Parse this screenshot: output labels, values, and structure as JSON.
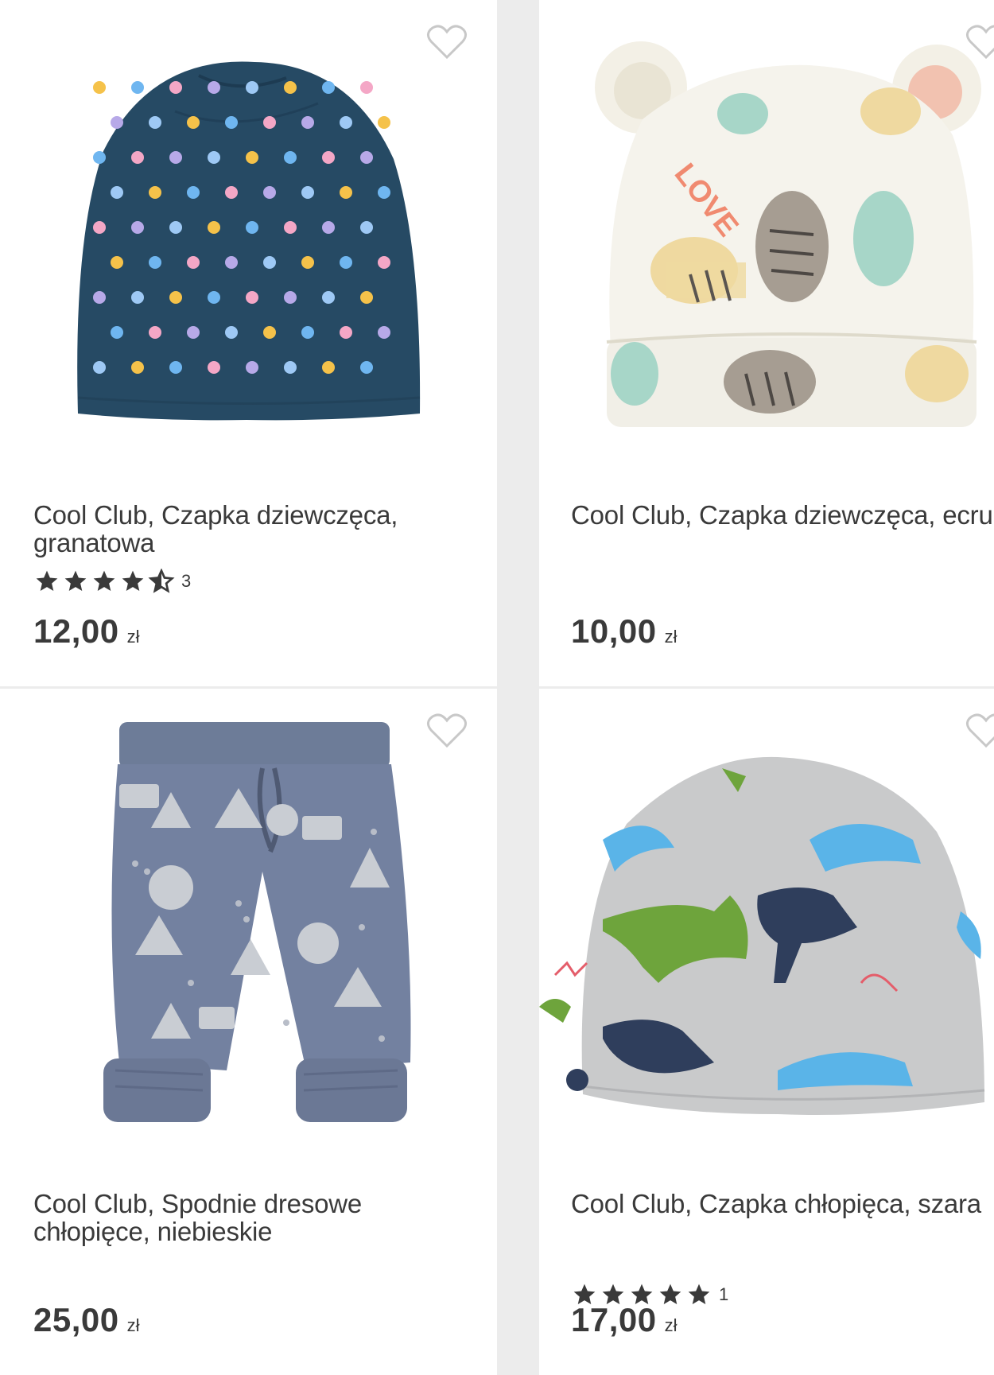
{
  "products": [
    {
      "title": "Cool Club, Czapka dziewczęca, granatowa",
      "rating": 4.5,
      "rating_count": "3",
      "price": "12,00",
      "currency": "zł",
      "image_icon": "navy-polka-dot-beanie"
    },
    {
      "title": "Cool Club, Czapka dziewczęca, ecru",
      "price": "10,00",
      "currency": "zł",
      "image_icon": "ecru-animal-print-hat-with-ears"
    },
    {
      "title": "Cool Club, Spodnie dresowe chłopięce, niebieskie",
      "price": "25,00",
      "currency": "zł",
      "image_icon": "blue-printed-sweatpants"
    },
    {
      "title": "Cool Club, Czapka chłopięca, szara",
      "rating": 5,
      "rating_count": "1",
      "price": "17,00",
      "currency": "zł",
      "image_icon": "grey-dinosaur-beanie"
    }
  ],
  "colors": {
    "navy": "#264a64",
    "text": "#3a3a3a",
    "heart": "#c8c8c8",
    "background": "#ececec"
  }
}
